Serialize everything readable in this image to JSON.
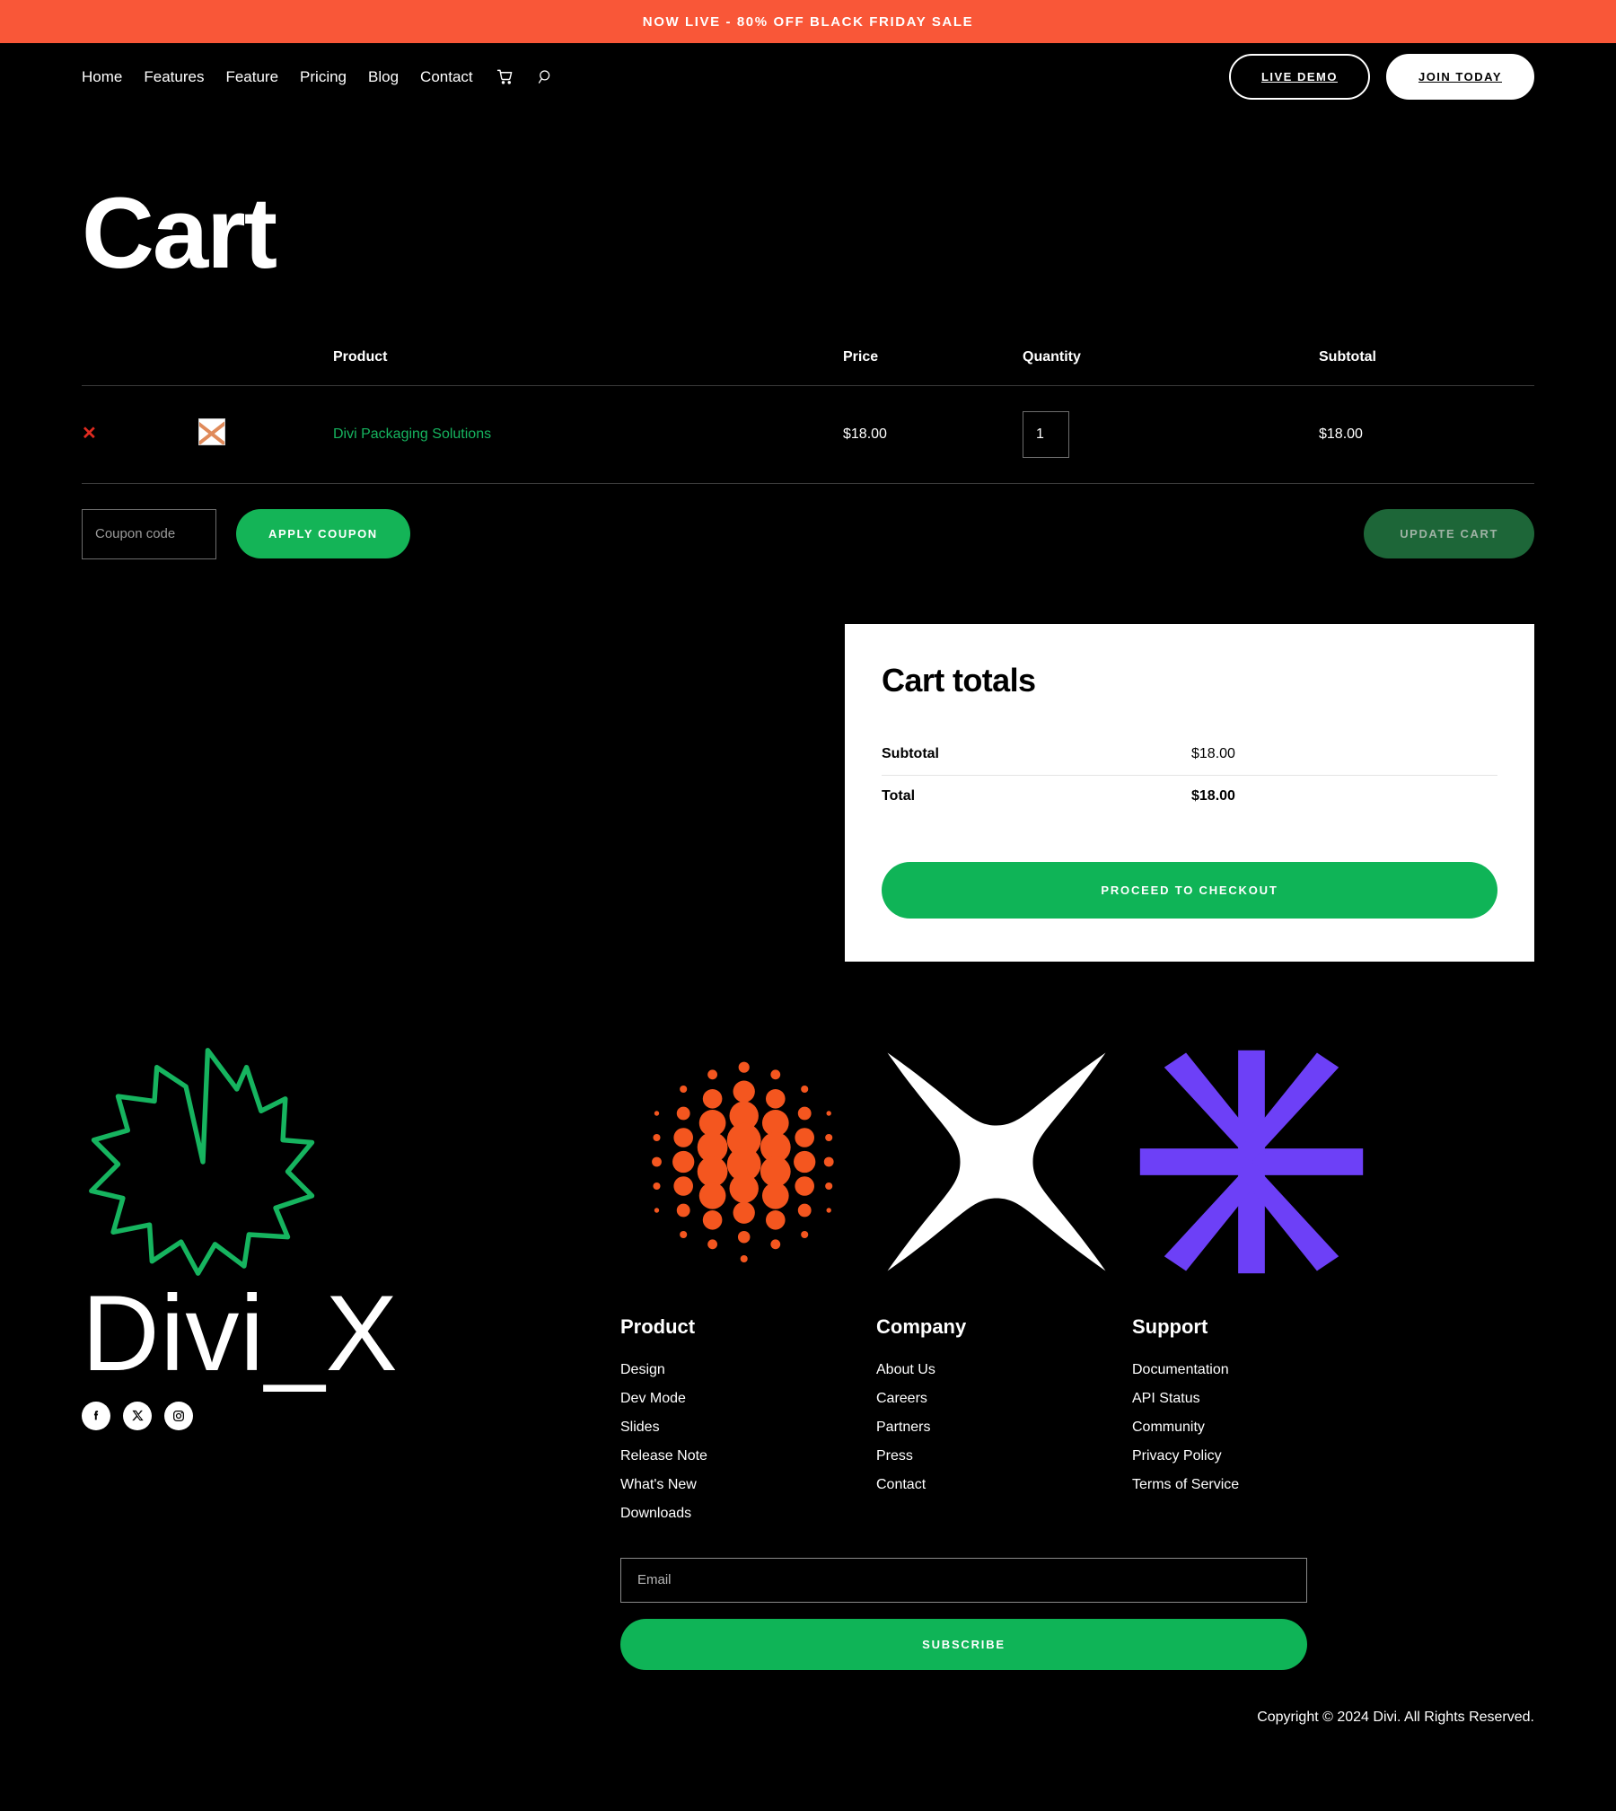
{
  "announcement": {
    "text": "NOW LIVE - 80% OFF BLACK FRIDAY SALE",
    "bg_color": "#f95738"
  },
  "header": {
    "nav_items": [
      {
        "label": "Home"
      },
      {
        "label": "Features"
      },
      {
        "label": "Feature"
      },
      {
        "label": "Pricing"
      },
      {
        "label": "Blog"
      },
      {
        "label": "Contact"
      }
    ],
    "cart_icon": "shopping-cart-icon",
    "search_icon": "search-icon",
    "live_demo_label": "LIVE DEMO",
    "join_today_label": "JOIN TODAY"
  },
  "page": {
    "title": "Cart"
  },
  "cart_table": {
    "headers": {
      "remove": "",
      "thumbnail": "",
      "product": "Product",
      "price": "Price",
      "quantity": "Quantity",
      "subtotal": "Subtotal"
    },
    "rows": [
      {
        "remove_label": "✕",
        "thumbnail": "broken-image-icon",
        "product": "Divi Packaging Solutions",
        "price": "$18.00",
        "quantity": "1",
        "subtotal": "$18.00"
      }
    ]
  },
  "coupon": {
    "placeholder": "Coupon code",
    "value": "",
    "apply_label": "APPLY COUPON",
    "update_label": "UPDATE CART"
  },
  "totals": {
    "title": "Cart totals",
    "rows": [
      {
        "label": "Subtotal",
        "value": "$18.00"
      },
      {
        "label": "Total",
        "value": "$18.00"
      }
    ],
    "checkout_label": "PROCEED TO CHECKOUT"
  },
  "footer": {
    "brand": "Divi_X",
    "logo_icon": "pinwheel-logo-icon",
    "logo_color": "#16b45f",
    "socials": [
      {
        "name": "facebook-icon"
      },
      {
        "name": "x-twitter-icon"
      },
      {
        "name": "instagram-icon"
      }
    ],
    "decorations": [
      {
        "name": "halftone-dots-graphic",
        "color": "#f4561f"
      },
      {
        "name": "four-point-star-graphic",
        "color": "#ffffff"
      },
      {
        "name": "eight-spoke-asterisk-graphic",
        "color": "#6d40f7"
      }
    ],
    "columns": [
      {
        "title": "Product",
        "links": [
          "Design",
          "Dev Mode",
          "Slides",
          "Release Note",
          "What's New",
          "Downloads"
        ]
      },
      {
        "title": "Company",
        "links": [
          "About Us",
          "Careers",
          "Partners",
          "Press",
          "Contact"
        ]
      },
      {
        "title": "Support",
        "links": [
          "Documentation",
          "API Status",
          "Community",
          "Privacy Policy",
          "Terms of Service"
        ]
      }
    ],
    "email_placeholder": "Email",
    "email_value": "",
    "subscribe_label": "SUBSCRIBE",
    "copyright": "Copyright © 2024 Divi. All Rights Reserved."
  },
  "colors": {
    "accent_green": "#0fb457",
    "accent_orange": "#f95738",
    "accent_purple": "#6d40f7",
    "product_link": "#16b45f",
    "remove_red": "#e02b20",
    "background": "#000000"
  }
}
